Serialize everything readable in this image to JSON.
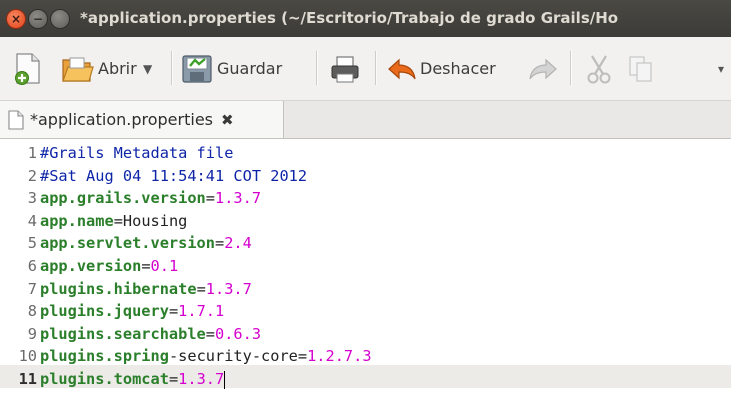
{
  "window": {
    "title": "*application.properties (~/Escritorio/Trabajo de grado Grails/Ho"
  },
  "toolbar": {
    "open_label": "Abrir",
    "save_label": "Guardar",
    "undo_label": "Deshacer",
    "icons": [
      "new-document-icon",
      "open-folder-icon",
      "dropdown-arrow-icon",
      "save-icon",
      "print-icon",
      "undo-icon",
      "redo-icon",
      "cut-icon",
      "copy-icon",
      "more-arrow-icon"
    ]
  },
  "tab": {
    "label": "*application.properties"
  },
  "editor": {
    "lines": [
      {
        "n": "1",
        "comment": "#Grails Metadata file"
      },
      {
        "n": "2",
        "comment": "#Sat Aug 04 11:54:41 COT 2012"
      },
      {
        "n": "3",
        "key": "app.grails.version",
        "value": "1.3.7"
      },
      {
        "n": "4",
        "key": "app.name",
        "text": "Housing"
      },
      {
        "n": "5",
        "key": "app.servlet.version",
        "value": "2.4"
      },
      {
        "n": "6",
        "key": "app.version",
        "value": "0.1"
      },
      {
        "n": "7",
        "key": "plugins.hibernate",
        "value": "1.3.7"
      },
      {
        "n": "8",
        "key": "plugins.jquery",
        "value": "1.7.1"
      },
      {
        "n": "9",
        "key": "plugins.searchable",
        "value": "0.6.3"
      },
      {
        "n": "10",
        "key": "plugins.spring",
        "key_rest": "-security-core",
        "value": "1.2.7.3"
      },
      {
        "n": "11",
        "key": "plugins.tomcat",
        "value": "1.3.7"
      }
    ]
  }
}
